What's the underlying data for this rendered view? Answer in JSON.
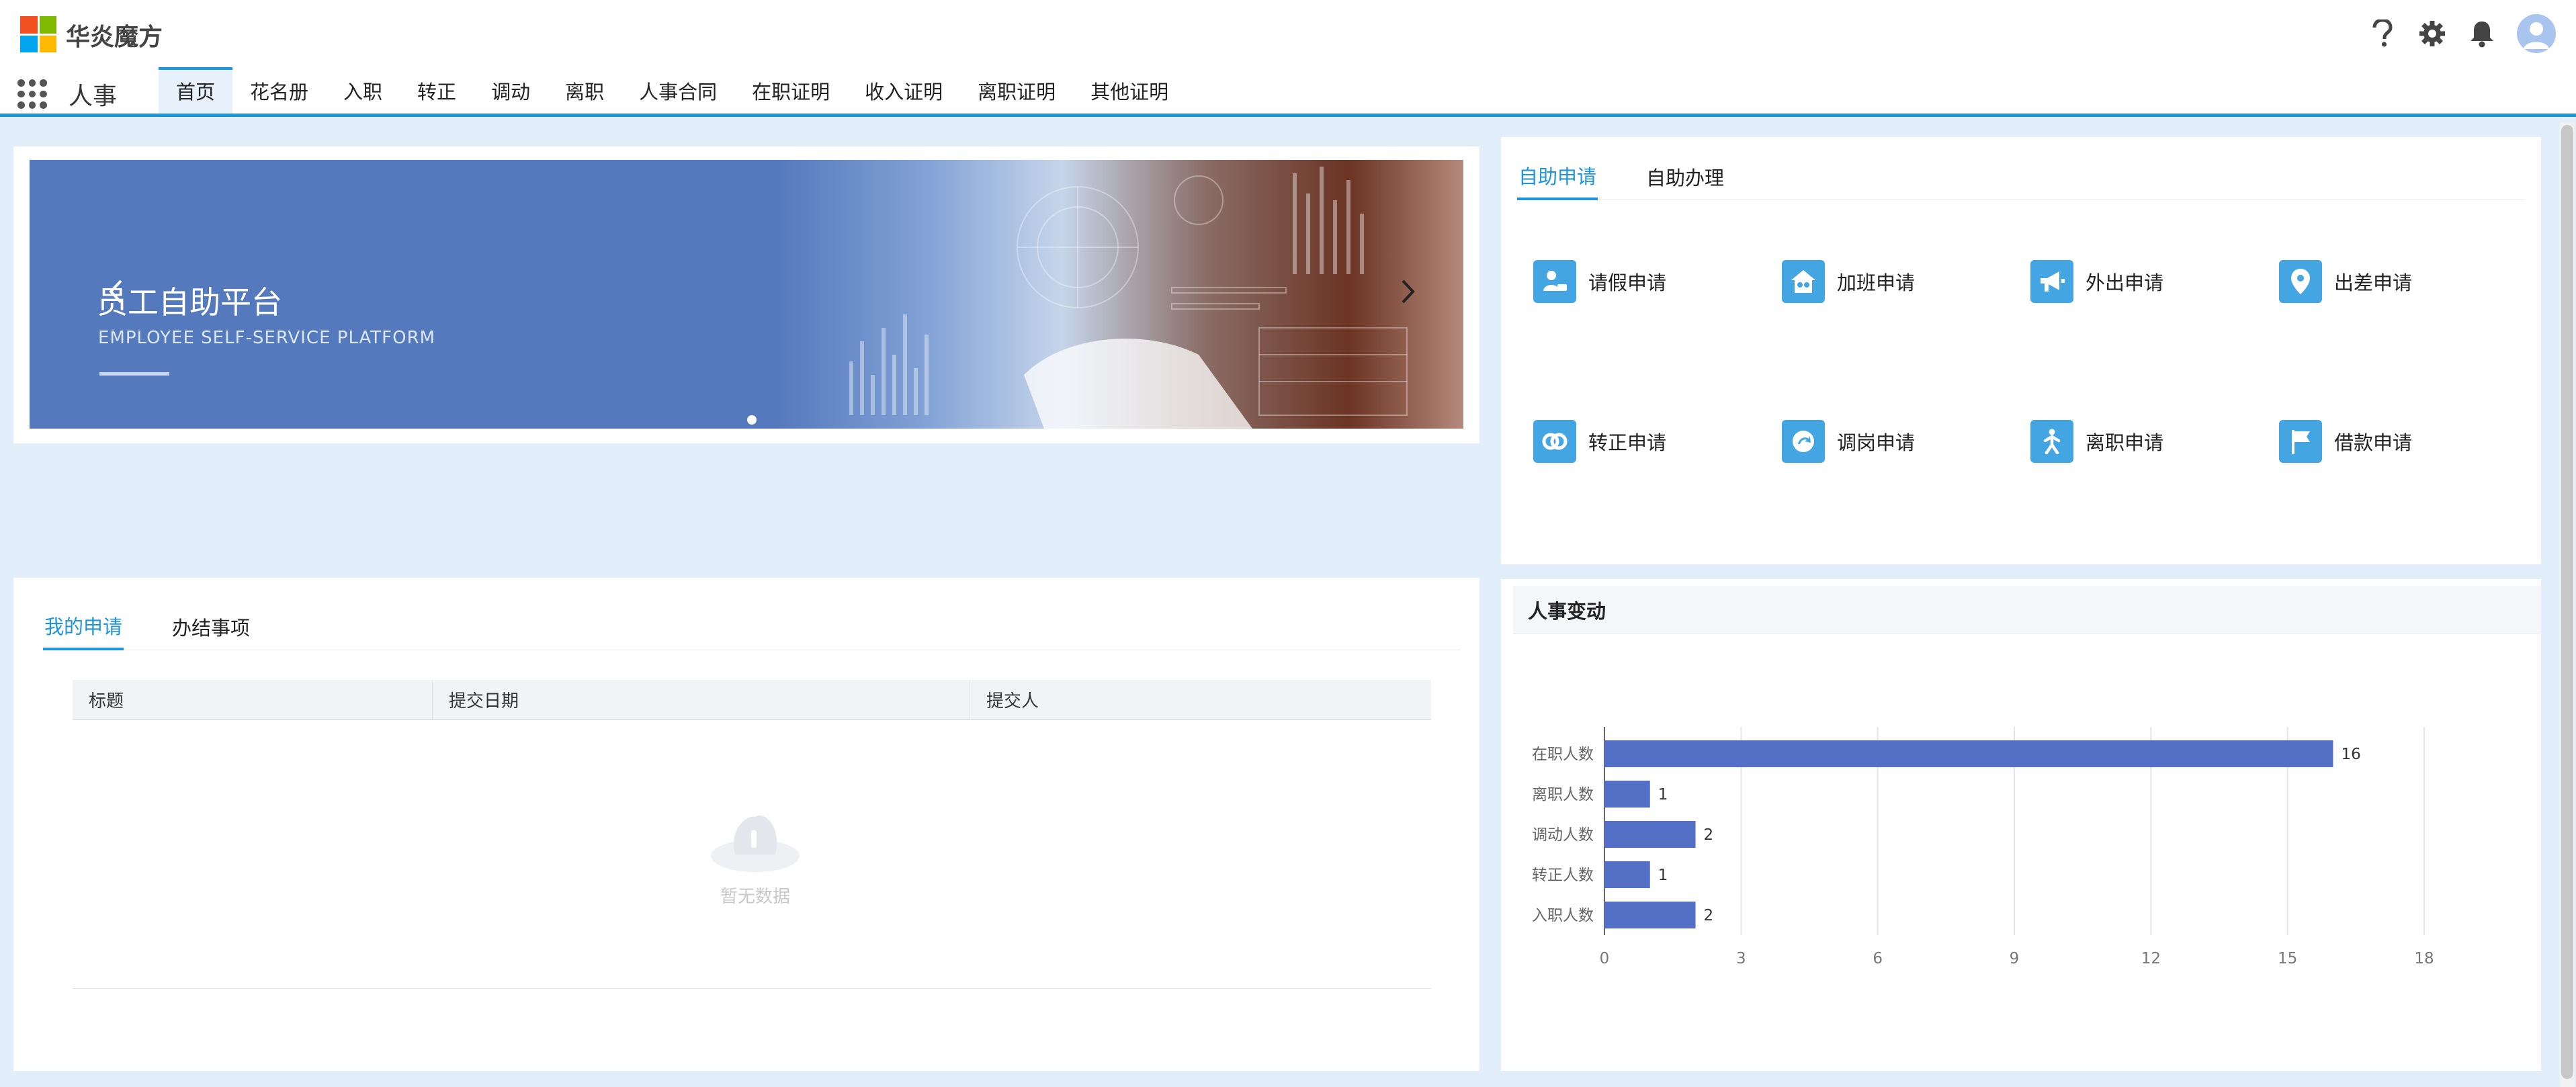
{
  "brand": {
    "name": "华炎魔方"
  },
  "module": {
    "name": "人事"
  },
  "nav": {
    "tabs": [
      "首页",
      "花名册",
      "入职",
      "转正",
      "调动",
      "离职",
      "人事合同",
      "在职证明",
      "收入证明",
      "离职证明",
      "其他证明"
    ],
    "active": 0
  },
  "banner": {
    "title": "员工自助平台",
    "subtitle": "EMPLOYEE SELF-SERVICE PLATFORM",
    "slide_count": 1,
    "current_slide": 1
  },
  "self_service": {
    "tabs": [
      "自助申请",
      "自助办理"
    ],
    "items": [
      {
        "label": "请假申请",
        "icon": "leave-icon"
      },
      {
        "label": "加班申请",
        "icon": "overtime-icon"
      },
      {
        "label": "外出申请",
        "icon": "megaphone-icon"
      },
      {
        "label": "出差申请",
        "icon": "location-pin-icon"
      },
      {
        "label": "转正申请",
        "icon": "rings-icon"
      },
      {
        "label": "调岗申请",
        "icon": "transfer-icon"
      },
      {
        "label": "离职申请",
        "icon": "walking-person-icon"
      },
      {
        "label": "借款申请",
        "icon": "flag-icon"
      }
    ]
  },
  "my_apply": {
    "tabs": [
      "我的申请",
      "办结事项"
    ],
    "columns": [
      "标题",
      "提交日期",
      "提交人"
    ],
    "rows": [],
    "empty_text": "暂无数据"
  },
  "hr_changes": {
    "title": "人事变动"
  },
  "chart_data": {
    "type": "bar",
    "orientation": "horizontal",
    "categories": [
      "在职人数",
      "离职人数",
      "调动人数",
      "转正人数",
      "入职人数"
    ],
    "values": [
      16,
      1,
      2,
      1,
      2
    ],
    "xlim": [
      0,
      18
    ],
    "xticks": [
      0,
      3,
      6,
      9,
      12,
      15,
      18
    ],
    "grid": true,
    "data_labels": true,
    "bar_color": "#5470c6"
  },
  "colors": {
    "accent": "#1d95dd",
    "icon_bg": "#44a5e3",
    "banner": "#5479bc",
    "logo": [
      "#f25022",
      "#7fba00",
      "#00a4ef",
      "#ffb900"
    ]
  }
}
